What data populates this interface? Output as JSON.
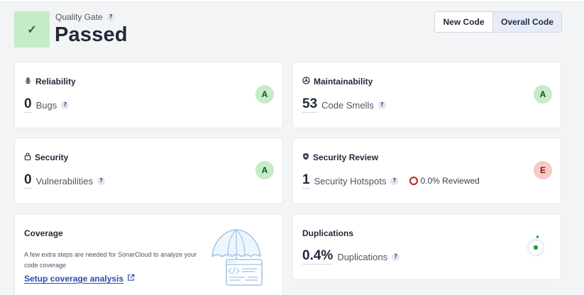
{
  "quality_gate": {
    "label": "Quality Gate",
    "help_icon": "?",
    "status": "Passed",
    "status_color": "#c6ebc7",
    "check_icon": "✓"
  },
  "code_toggle": {
    "new_label": "New Code",
    "overall_label": "Overall Code",
    "selected": "Overall Code"
  },
  "cards": {
    "reliability": {
      "title": "Reliability",
      "icon": "bug-icon",
      "value": "0",
      "label": "Bugs",
      "help": "?",
      "rating": "A"
    },
    "maintainability": {
      "title": "Maintainability",
      "icon": "maintainability-icon",
      "value": "53",
      "label": "Code Smells",
      "help": "?",
      "rating": "A"
    },
    "security": {
      "title": "Security",
      "icon": "lock-icon",
      "value": "0",
      "label": "Vulnerabilities",
      "help": "?",
      "rating": "A"
    },
    "security_review": {
      "title": "Security Review",
      "icon": "shield-icon",
      "value": "1",
      "label": "Security Hotspots",
      "help": "?",
      "reviewed": "0.0% Reviewed",
      "rating": "E"
    },
    "coverage": {
      "title": "Coverage",
      "description": "A few extra steps are needed for SonarCloud to analyze your code coverage",
      "link": "Setup coverage analysis",
      "illustration": "umbrella-code-icon"
    },
    "duplications": {
      "title": "Duplications",
      "value": "0.4%",
      "label": "Duplications",
      "help": "?",
      "indicator": "duplication-donut-icon"
    }
  },
  "colors": {
    "rating_a": "#c6ebc7",
    "rating_e": "#f9c9c3",
    "link": "#2b4cae",
    "accent_green": "#16a34a"
  }
}
